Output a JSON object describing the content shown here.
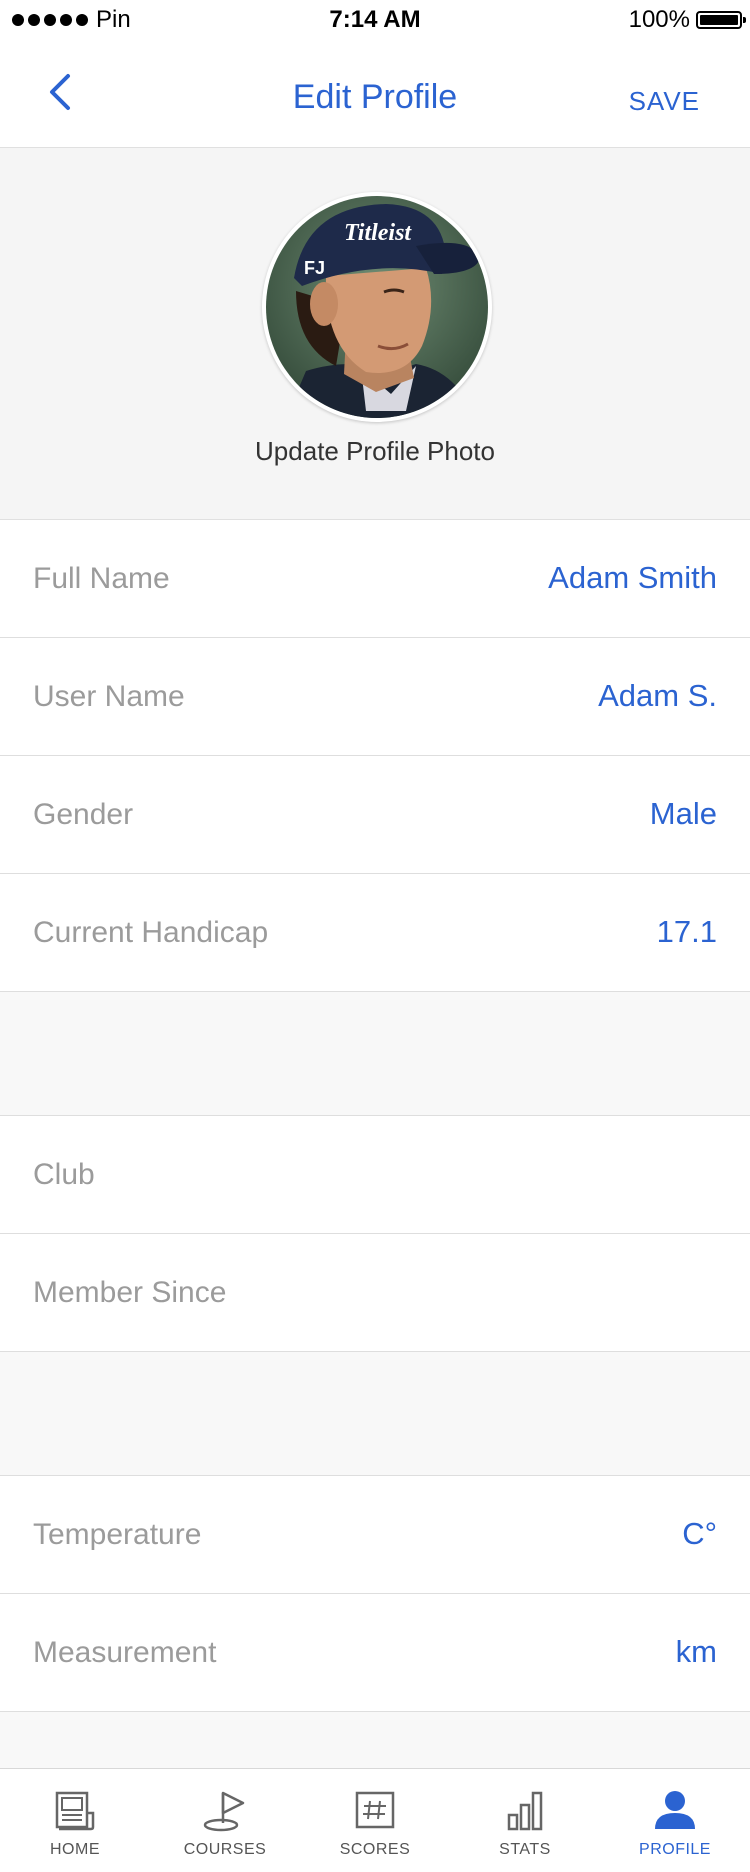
{
  "status_bar": {
    "carrier": "Pin",
    "time": "7:14 AM",
    "battery": "100%"
  },
  "nav": {
    "title": "Edit Profile",
    "save_label": "SAVE"
  },
  "profile_photo": {
    "update_label": "Update Profile Photo"
  },
  "fields_personal": [
    {
      "label": "Full Name",
      "value": "Adam Smith"
    },
    {
      "label": "User Name",
      "value": "Adam S."
    },
    {
      "label": "Gender",
      "value": "Male"
    },
    {
      "label": "Current Handicap",
      "value": "17.1"
    }
  ],
  "fields_club": [
    {
      "label": "Club",
      "value": ""
    },
    {
      "label": "Member Since",
      "value": ""
    }
  ],
  "fields_units": [
    {
      "label": "Temperature",
      "value": "C°"
    },
    {
      "label": "Measurement",
      "value": "km"
    }
  ],
  "tabs": [
    {
      "label": "HOME",
      "icon": "home-icon"
    },
    {
      "label": "COURSES",
      "icon": "courses-icon"
    },
    {
      "label": "SCORES",
      "icon": "scores-icon"
    },
    {
      "label": "STATS",
      "icon": "stats-icon"
    },
    {
      "label": "PROFILE",
      "icon": "profile-icon",
      "active": true
    }
  ],
  "colors": {
    "accent": "#2b63d1",
    "label_gray": "#9b9b9b",
    "background": "#f8f8f8"
  }
}
